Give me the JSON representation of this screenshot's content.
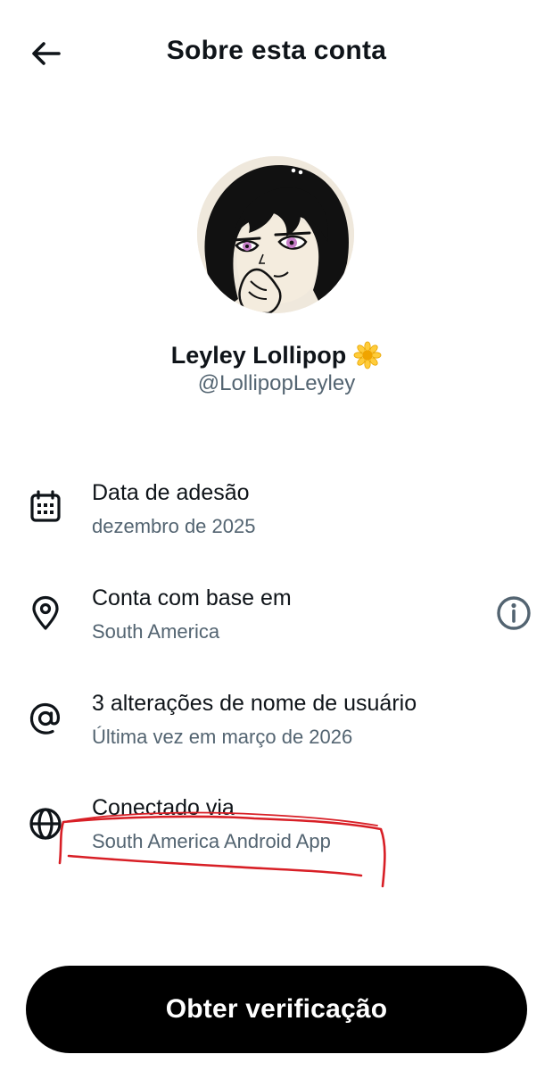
{
  "header": {
    "title": "Sobre esta conta",
    "back_icon": "arrow-left-icon"
  },
  "profile": {
    "display_name": "Leyley Lollipop",
    "name_emoji_icon": "sunflower-icon",
    "handle": "@LollipopLeyley",
    "avatar_icon": "avatar-illustration"
  },
  "info": [
    {
      "icon": "calendar-icon",
      "label": "Data de adesão",
      "value": "dezembro de 2025"
    },
    {
      "icon": "location-pin-icon",
      "label": "Conta com base em",
      "value": "South America",
      "action_icon": "info-circle-icon"
    },
    {
      "icon": "at-sign-icon",
      "label": "3 alterações de nome de usuário",
      "value": "Última vez em março de 2026"
    },
    {
      "icon": "globe-icon",
      "label": "Conectado via",
      "value": "South America Android App"
    }
  ],
  "cta": {
    "label": "Obter verificação"
  },
  "colors": {
    "primary_text": "#0f1419",
    "secondary_text": "#536471",
    "button_bg": "#000000",
    "annotation": "#d81f26"
  }
}
